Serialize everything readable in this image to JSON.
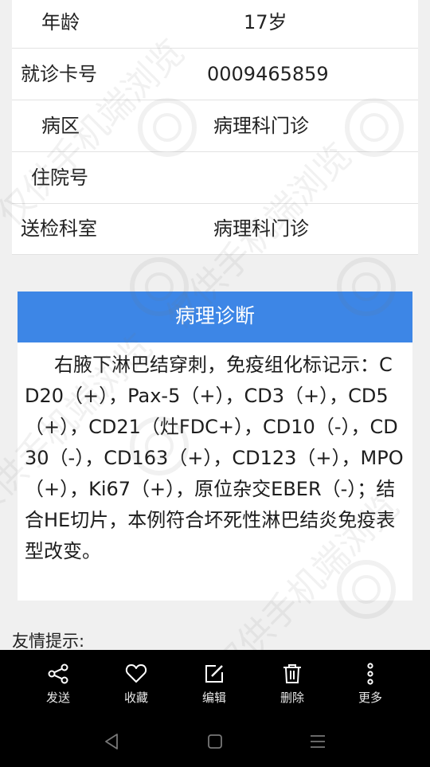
{
  "patient_info": {
    "rows": [
      {
        "label": "年龄",
        "value": "17岁"
      },
      {
        "label": "就诊卡号",
        "value": "0009465859"
      },
      {
        "label": "病区",
        "value": "病理科门诊"
      },
      {
        "label": "住院号",
        "value": ""
      },
      {
        "label": "送检科室",
        "value": "病理科门诊"
      }
    ]
  },
  "diagnosis": {
    "title": "病理诊断",
    "text": "右腋下淋巴结穿刺，免疫组化标记示：CD20（+），Pax-5（+），CD3（+），CD5（+），CD21（灶FDC+），CD10（-），CD30（-），CD163（+），CD123（+），MPO（+），Ki67（+），原位杂交EBER（-）；结合HE切片，本例符合坏死性淋巴结炎免疫表型改变。"
  },
  "tip": {
    "label": "友情提示:"
  },
  "toolbar": {
    "items": [
      {
        "label": "发送",
        "icon": "share-icon"
      },
      {
        "label": "收藏",
        "icon": "heart-icon"
      },
      {
        "label": "编辑",
        "icon": "edit-icon"
      },
      {
        "label": "删除",
        "icon": "trash-icon"
      },
      {
        "label": "更多",
        "icon": "more-vertical-icon"
      }
    ]
  },
  "navbar": {
    "icons": [
      "back-icon",
      "home-icon",
      "menu-icon"
    ]
  },
  "watermark": {
    "text": "仅供手机端浏览"
  },
  "colors": {
    "header_blue": "#3d86e6",
    "toolbar_bg": "#000000",
    "page_bg": "#f0f0f0",
    "card_bg": "#ffffff"
  }
}
